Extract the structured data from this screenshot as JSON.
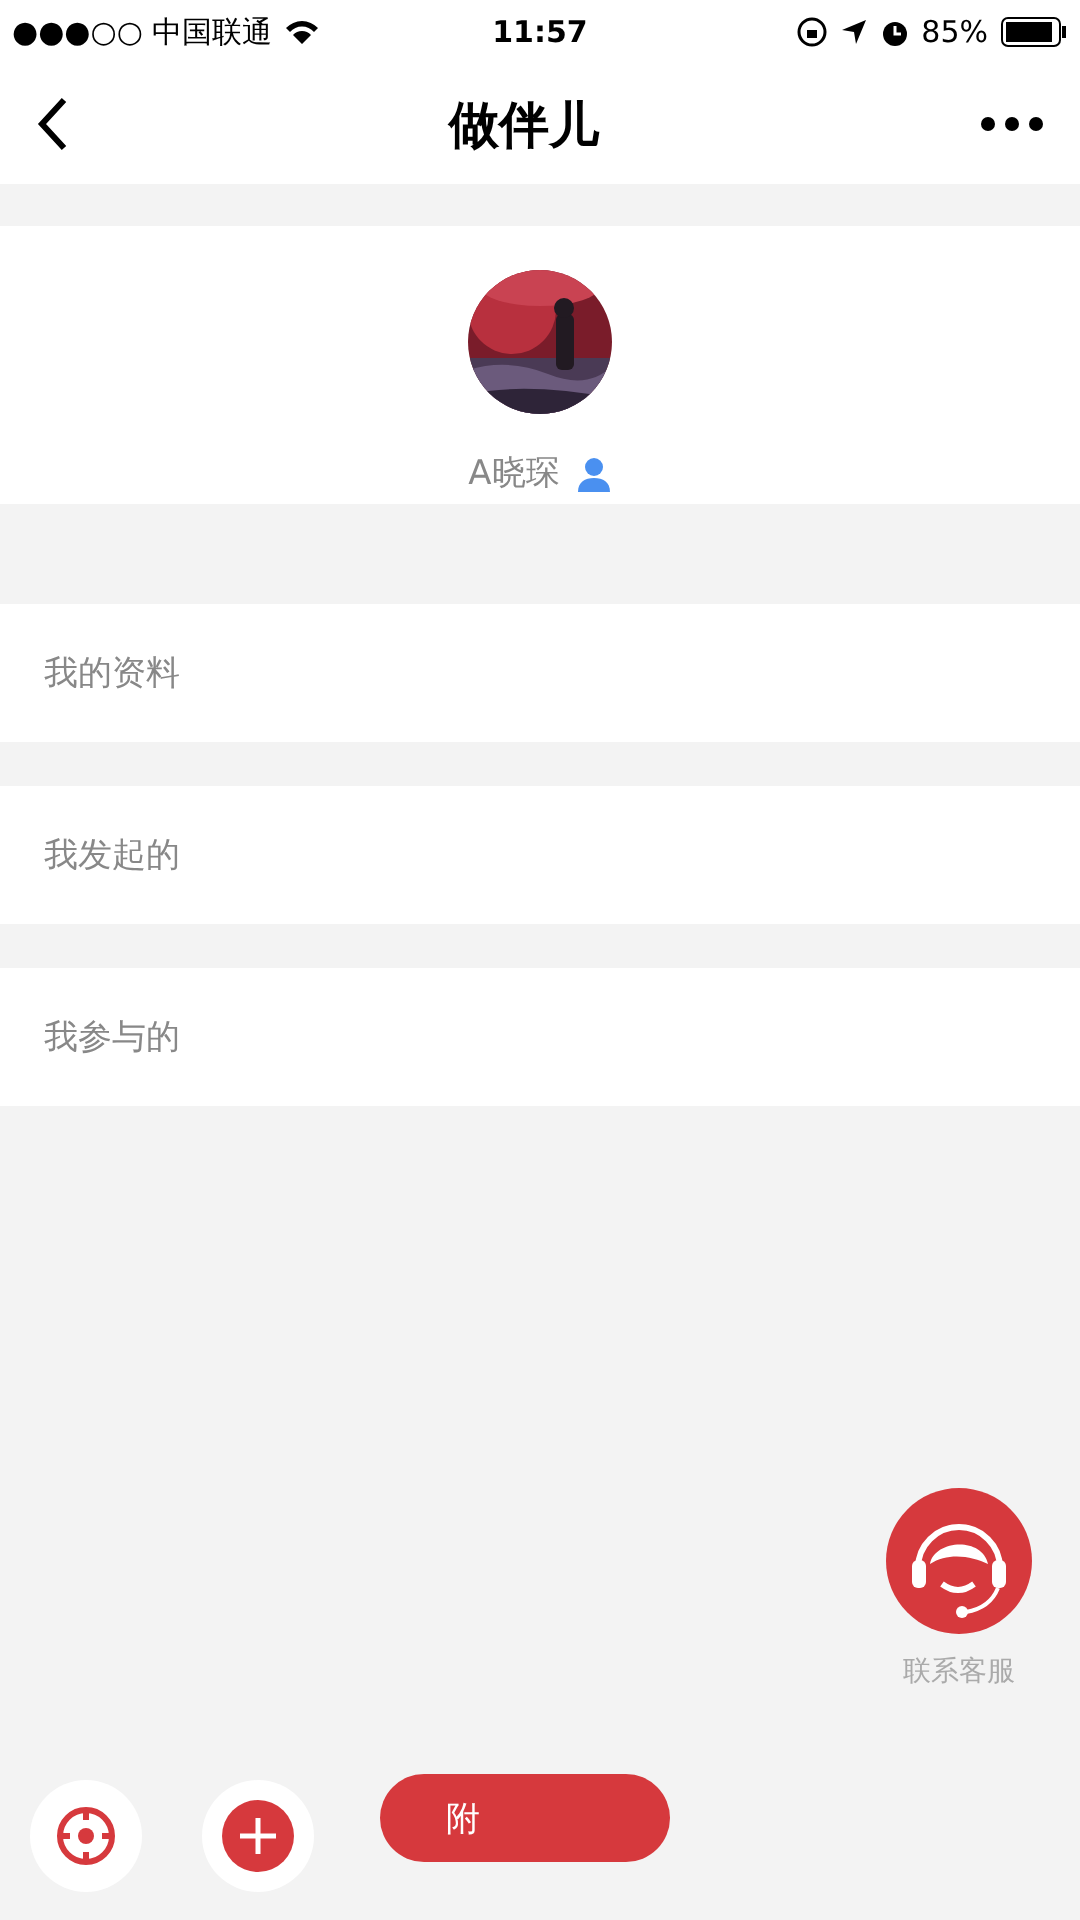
{
  "status_bar": {
    "carrier": "●●●○○ 中国联通",
    "time": "11:57",
    "battery": "85%"
  },
  "nav": {
    "title": "做伴儿"
  },
  "profile": {
    "name": "A晓琛"
  },
  "menu": [
    {
      "label": "我的资料"
    },
    {
      "label": "我发起的"
    },
    {
      "label": "我参与的"
    }
  ],
  "service": {
    "label": "联系客服"
  },
  "bottom": {
    "nearby_label": "附"
  }
}
